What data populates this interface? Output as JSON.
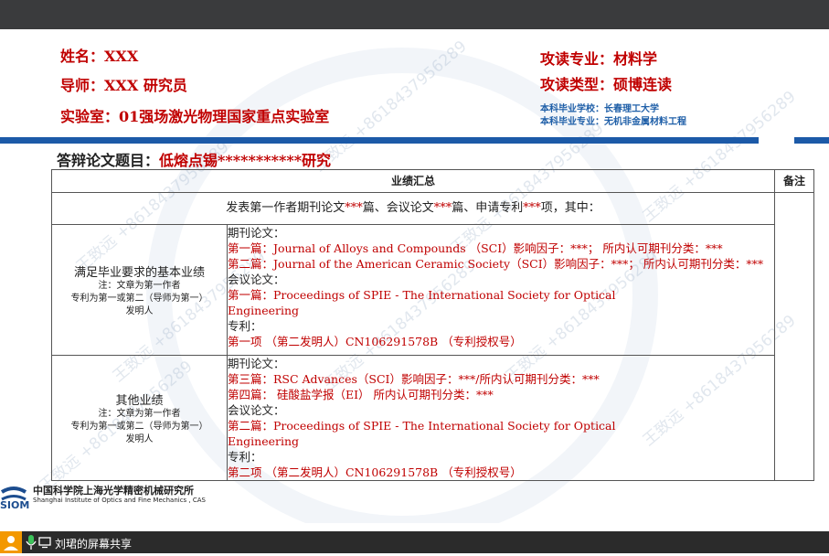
{
  "header": {
    "name": "姓名：XXX",
    "advisor": "导师：XXX  研究员",
    "lab": "实验室：01强场激光物理国家重点实验室",
    "major": "攻读专业：材料学",
    "degree_type": "攻读类型：硕博连读",
    "undergrad_school": "本科毕业学校：长春理工大学",
    "undergrad_major": "本科毕业专业：无机非金属材料工程"
  },
  "thesis": {
    "label": "答辩论文题目：",
    "title": "低熔点锡***********研究"
  },
  "table": {
    "col_header": "业绩汇总",
    "notes_header": "备注",
    "summary_pre": "发表第一作者期刊论文",
    "summary_a": "***",
    "summary_mid1": "篇、会议论文",
    "summary_b": "***",
    "summary_mid2": "篇、申请专利",
    "summary_c": "***",
    "summary_post": "项，其中：",
    "sections": [
      {
        "title": "满足毕业要求的基本业绩",
        "note1": "注：文章为第一作者",
        "note2": "专利为第一或第二（导师为第一）",
        "note3": "发明人",
        "lines": [
          {
            "text": "期刊论文：",
            "style": "k"
          },
          {
            "text": "第一篇：Journal of Alloys and Compounds （SCI）影响因子：***； 所内认可期刊分类：***",
            "style": "r"
          },
          {
            "text": "第二篇：Journal of the American Ceramic Society（SCI）影响因子：***； 所内认可期刊分类：***",
            "style": "r"
          },
          {
            "text": "会议论文：",
            "style": "k"
          },
          {
            "text": "第一篇：Proceedings of SPIE - The International Society for Optical",
            "style": "r"
          },
          {
            "text": "Engineering",
            "style": "r"
          },
          {
            "text": "专利：",
            "style": "k"
          },
          {
            "text": "第一项 （第二发明人）CN106291578B （专利授权号）",
            "style": "r"
          }
        ]
      },
      {
        "title": "其他业绩",
        "note1": "注：文章为第一作者",
        "note2": "专利为第一或第二（导师为第一）",
        "note3": "发明人",
        "lines": [
          {
            "text": "期刊论文：",
            "style": "k"
          },
          {
            "text": "第三篇：RSC Advances（SCI）影响因子：***/所内认可期刊分类：***",
            "style": "r"
          },
          {
            "text": "第四篇： 硅酸盐学报（EI） 所内认可期刊分类：***",
            "style": "r"
          },
          {
            "text": "会议论文：",
            "style": "k"
          },
          {
            "text": "第二篇：Proceedings of SPIE - The International Society for Optical",
            "style": "r"
          },
          {
            "text": "Engineering",
            "style": "r"
          },
          {
            "text": "专利：",
            "style": "k"
          },
          {
            "text": "第二项 （第二发明人）CN106291578B （专利授权号）",
            "style": "r"
          }
        ]
      }
    ]
  },
  "watermark": {
    "text": "王致远 +8618437956289"
  },
  "logo": {
    "abbr": "SIOM",
    "cn": "中国科学院上海光学精密机械研究所",
    "en": "Shanghai Institute of Optics and Fine Mechanics , CAS"
  },
  "screen_share": {
    "label": "刘珺的屏幕共享"
  },
  "colors": {
    "accent_red": "#c00000",
    "bar_blue": "#1c5aa8",
    "top_bar": "#3a3b3d",
    "share_bar": "#2b2b2b",
    "share_orange": "#f39800"
  }
}
